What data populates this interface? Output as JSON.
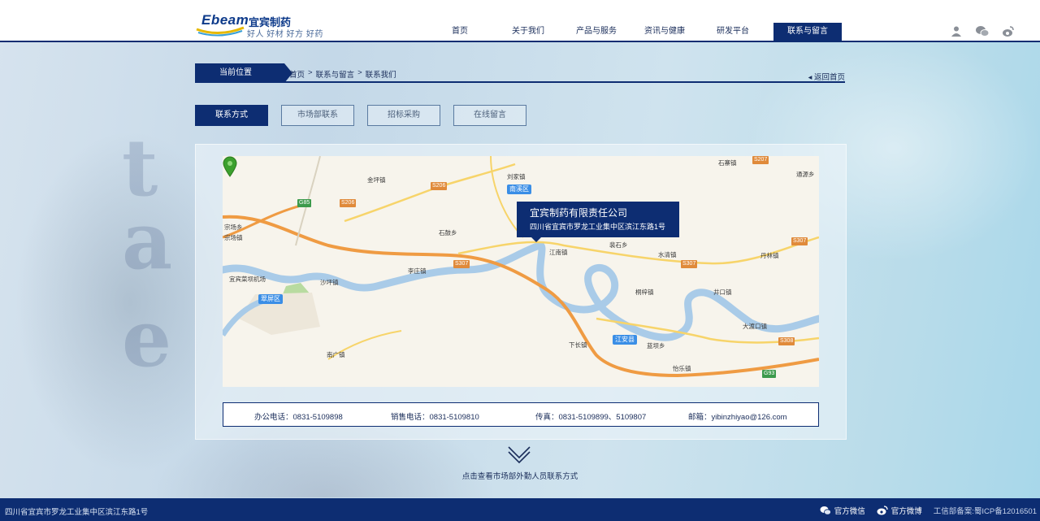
{
  "header": {
    "logo_en": "Ebeam",
    "logo_cn": "宜宾制药",
    "slogan": "好人 好材  好方  好药",
    "nav": [
      "首页",
      "关于我们",
      "产品与服务",
      "资讯与健康",
      "研发平台",
      "联系与留言"
    ],
    "active_nav": "联系与留言",
    "icons": [
      "user-icon",
      "wechat-icon",
      "weibo-icon"
    ]
  },
  "breadcrumb": {
    "label": "当前位置",
    "path": [
      "首页",
      ">",
      "联系与留言",
      ">",
      "联系我们"
    ],
    "back": "返回首页"
  },
  "tabs": [
    "联系方式",
    "市场部联系",
    "招标采购",
    "在线留言"
  ],
  "active_tab": "联系方式",
  "map": {
    "callout_title": "宜宾制药有限责任公司",
    "callout_address": "四川省宜宾市罗龙工业集中区滨江东路1号",
    "places": [
      "金坪镇",
      "刘家镇",
      "石寨镇",
      "通源乡",
      "宗场乡",
      "宗场镇",
      "石鼓乡",
      "裴石乡",
      "水清镇",
      "丹林镇",
      "江南镇",
      "李庄镇",
      "宜宾菜坝机场",
      "沙坪镇",
      "桐梓镇",
      "井口镇",
      "大渡口镇",
      "南广镇",
      "下长镇",
      "蓝坝乡",
      "怡乐镇"
    ],
    "districts": [
      "南溪区",
      "翠屏区",
      "江安县"
    ],
    "roads": [
      "S207",
      "S206",
      "G85",
      "S307",
      "G93",
      "S308"
    ]
  },
  "contact": {
    "office_phone": "办公电话：0831-5109898",
    "sales_phone": "销售电话：0831-5109810",
    "fax": "传真：0831-5109899、5109807",
    "email": "邮箱：yibinzhiyao@126.com"
  },
  "expand_text": "点击查看市场部外勤人员联系方式",
  "footer": {
    "address": "四川省宜宾市罗龙工业集中区滨江东路1号",
    "wechat": "官方微信",
    "weibo": "官方微博",
    "icp": "工信部备案:蜀ICP备12016501"
  },
  "colors": {
    "primary": "#0d2d72",
    "accent": "#3a8ee6"
  }
}
